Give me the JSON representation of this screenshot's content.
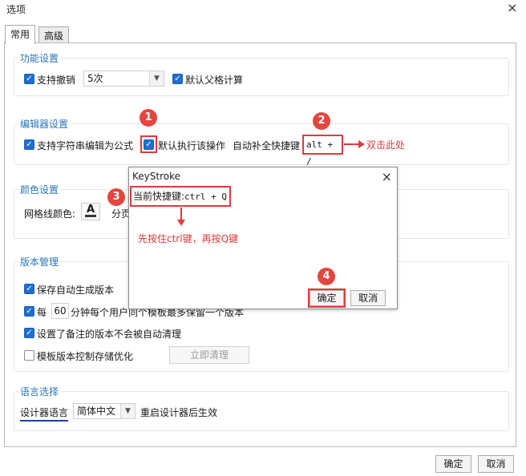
{
  "window": {
    "title": "选项",
    "close_icon": "×"
  },
  "tabs": [
    {
      "label": "常用",
      "active": true
    },
    {
      "label": "高级",
      "active": false
    }
  ],
  "features": {
    "title": "功能设置",
    "undo_label": "支持撤销",
    "undo_count": "5次",
    "default_parent_label": "默认父格计算"
  },
  "editor": {
    "title": "编辑器设置",
    "string_formula_label": "支持字符串编辑为公式",
    "default_exec_label": "默认执行该操作",
    "autocomplete_label": "自动补全快捷键",
    "shortcut_value": "alt + /"
  },
  "color": {
    "title": "颜色设置",
    "grid_color_label": "网格线颜色:",
    "page_label": "分页"
  },
  "version": {
    "title": "版本管理",
    "auto_version_label": "保存自动生成版本",
    "every_label": "每",
    "minutes_value": "60",
    "minutes_desc": "分钟每个用户同个模板最多保留一个版本",
    "noted_label": "设置了备注的版本不会被自动清理",
    "storage_label": "模板版本控制存储优化",
    "clean_button": "立即清理"
  },
  "language": {
    "title": "语言选择",
    "designer_lang_label": "设计器语言",
    "lang_value": "简体中文",
    "restart_note": "重启设计器后生效"
  },
  "footer": {
    "ok": "确定",
    "cancel": "取消"
  },
  "keystroke_dialog": {
    "title": "KeyStroke",
    "close_icon": "×",
    "current_label": "当前快捷键:",
    "current_value": "ctrl + Q",
    "ok": "确定",
    "cancel": "取消"
  },
  "annotations": {
    "badge1": "1",
    "badge2": "2",
    "badge3": "3",
    "badge4": "4",
    "double_click": "双击此处",
    "instruction": "先按住ctrl键，再按Q键"
  }
}
